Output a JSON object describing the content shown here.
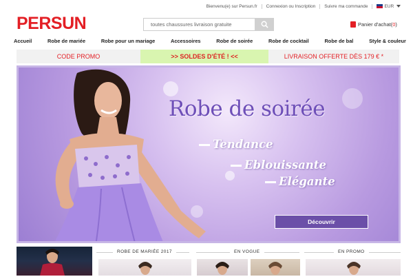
{
  "topbar": {
    "welcome": "Bienvenu(e) sur Persun.fr",
    "login": "Connexion ou Inscription",
    "track": "Suivre ma commande",
    "currency": "EUR"
  },
  "header": {
    "logo": "PERSUN",
    "search_placeholder": "toutes chaussures livraison gratuite",
    "cart_label": "Panier d'achat(",
    "cart_count": "0",
    "cart_close": ")"
  },
  "nav": {
    "items": [
      "Accueil",
      "Robe de mariée",
      "Robe pour un mariage",
      "Accessoires",
      "Robe de soirée",
      "Robe de cocktail",
      "Robe de bal",
      "Style & couleur"
    ]
  },
  "promo": {
    "code": "CODE PROMO",
    "sale": ">> SOLDES D'ÉTÉ ! <<",
    "shipping": "LIVRAISON OFFERTE DÈS 179 € *"
  },
  "banner": {
    "headline": "Robe de soirée",
    "tags": [
      "Tendance",
      "Eblouissante",
      "Elégante"
    ],
    "cta": "Découvrir"
  },
  "sections": {
    "bridal": "ROBE DE MARIÉE 2017",
    "vogue": "EN VOGUE",
    "promo": "EN PROMO"
  },
  "colors": {
    "brand": "#e31f25",
    "banner_purple": "#6b4fa8",
    "promo_green": "#d9f5b0"
  },
  "icons": [
    "search-icon",
    "flag-icon",
    "caret-down-icon",
    "shopping-bag-icon"
  ]
}
